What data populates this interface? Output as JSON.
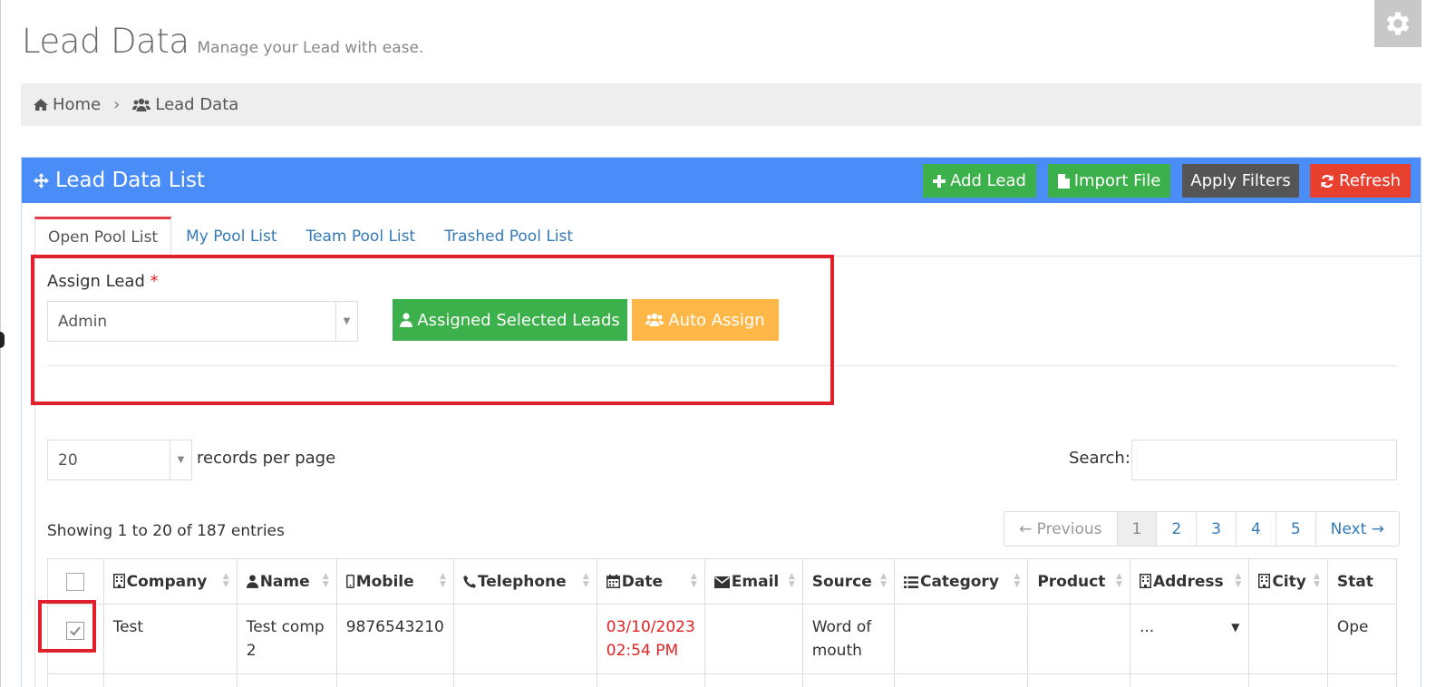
{
  "page": {
    "title": "Lead Data",
    "subtitle": "Manage your Lead with ease."
  },
  "breadcrumb": {
    "home": "Home",
    "current": "Lead Data"
  },
  "portlet": {
    "title": "Lead Data List",
    "add_lead": "Add Lead",
    "import_file": "Import File",
    "apply_filters": "Apply Filters",
    "refresh": "Refresh"
  },
  "tabs": [
    "Open Pool List",
    "My Pool List",
    "Team Pool List",
    "Trashed Pool List"
  ],
  "assign": {
    "label": "Assign Lead",
    "required_mark": "*",
    "selected": "Admin",
    "assign_selected_button": "Assigned Selected Leads",
    "auto_assign_button": "Auto Assign"
  },
  "table_controls": {
    "records_per_page": "20",
    "records_per_page_label": "records per page",
    "search_label": "Search:",
    "search_value": "",
    "showing": "Showing 1 to 20 of 187 entries"
  },
  "pagination": {
    "previous": "← Previous",
    "pages": [
      "1",
      "2",
      "3",
      "4",
      "5"
    ],
    "active_page": "1",
    "next": "Next →"
  },
  "table": {
    "columns": [
      "Company",
      "Name",
      "Mobile",
      "Telephone",
      "Date",
      "Email",
      "Source",
      "Category",
      "Product",
      "Address",
      "City",
      "Stat"
    ],
    "rows": [
      {
        "checked": true,
        "company": "Test",
        "name_line1": "Test comp",
        "name_line2": "2",
        "mobile": "9876543210",
        "telephone": "",
        "date_line1": "03/10/2023",
        "date_line2": "02:54 PM",
        "email": "",
        "source_line1": "Word of",
        "source_line2": "mouth",
        "category": "",
        "product": "",
        "address": "...",
        "city": "",
        "status": "Ope"
      }
    ]
  },
  "colors": {
    "header_blue": "#4b8df8",
    "green": "#3cb04a",
    "orange": "#ffb848",
    "dark": "#555555",
    "red": "#e7402f",
    "highlight_red": "#e0202a",
    "date_red": "#e02222"
  }
}
